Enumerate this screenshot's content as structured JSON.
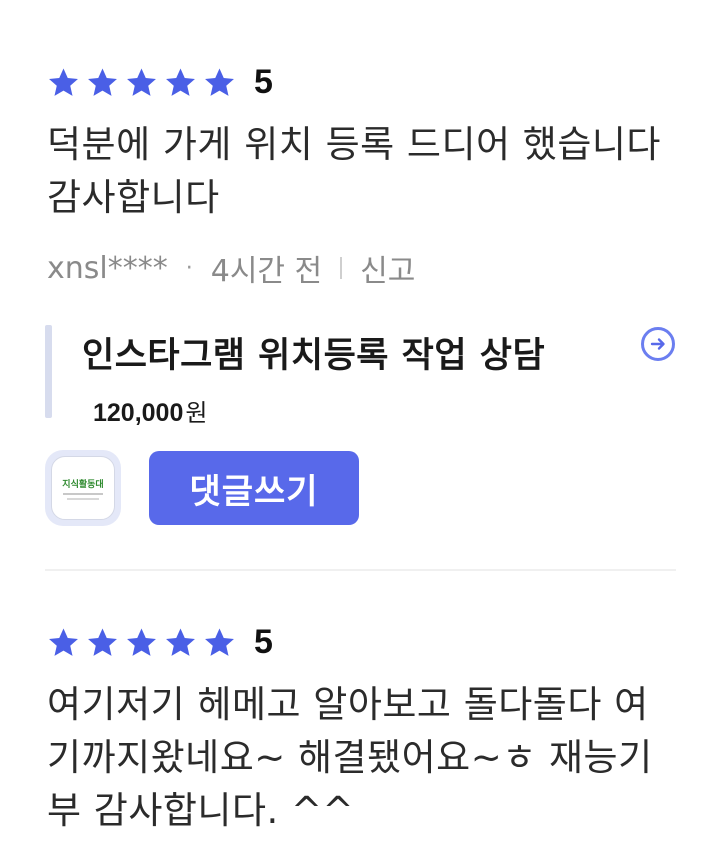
{
  "colors": {
    "star": "#4a5fe6",
    "accent": "#5869ea",
    "meta_text": "#8a8a8a",
    "quote_bar": "#d7dcee"
  },
  "reviews": [
    {
      "stars": 5,
      "rating": "5",
      "text": "덕분에 가게 위치 등록 드디어 했습니다\n감사합니다",
      "author": "xnsl****",
      "dot": "·",
      "time": "4시간 전",
      "report": "신고"
    },
    {
      "stars": 5,
      "rating": "5",
      "text": "여기저기 헤메고 알아보고 돌다돌다 여\n기까지왔네요~ 해결됐어요~ㅎ 재능기\n부 감사합니다. ^^"
    }
  ],
  "product": {
    "title": "인스타그램 위치등록 작업 상담",
    "price": "120,000",
    "currency": "원",
    "arrow_icon": "arrow-right-circle-icon"
  },
  "actions": {
    "app_icon_title": "지식활동대",
    "comment_button": "댓글쓰기"
  }
}
